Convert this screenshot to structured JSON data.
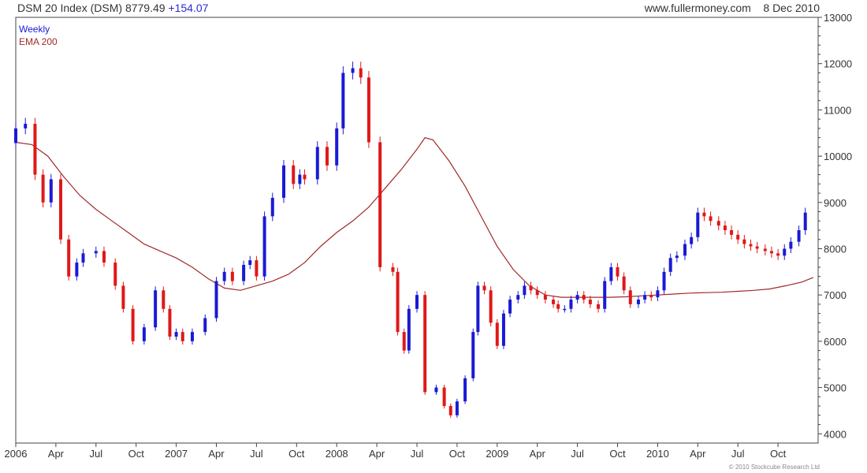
{
  "header": {
    "symbol": "DSM 20 Index (DSM)",
    "last": "8779.49",
    "change": "+154.07",
    "site": "www.fullermoney.com",
    "date": "8 Dec 2010"
  },
  "legend": {
    "weekly": "Weekly",
    "ema": "EMA 200"
  },
  "copyright": "© 2010 Stockcube Research Ltd",
  "colors": {
    "up": "#1a1ad4",
    "down": "#e01818",
    "ema": "#a02a2a",
    "grid": "#d9d9d9",
    "axis": "#444444"
  },
  "chart_data": {
    "type": "candlestick",
    "ylim": [
      3800,
      13000
    ],
    "y_ticks": [
      4000,
      5000,
      6000,
      7000,
      8000,
      9000,
      10000,
      11000,
      12000,
      13000
    ],
    "x_range": [
      2006.0,
      2011.0
    ],
    "x_ticks": [
      {
        "t": 2006.0,
        "label": "2006"
      },
      {
        "t": 2006.25,
        "label": "Apr"
      },
      {
        "t": 2006.5,
        "label": "Jul"
      },
      {
        "t": 2006.75,
        "label": "Oct"
      },
      {
        "t": 2007.0,
        "label": "2007"
      },
      {
        "t": 2007.25,
        "label": "Apr"
      },
      {
        "t": 2007.5,
        "label": "Jul"
      },
      {
        "t": 2007.75,
        "label": "Oct"
      },
      {
        "t": 2008.0,
        "label": "2008"
      },
      {
        "t": 2008.25,
        "label": "Apr"
      },
      {
        "t": 2008.5,
        "label": "Jul"
      },
      {
        "t": 2008.75,
        "label": "Oct"
      },
      {
        "t": 2009.0,
        "label": "2009"
      },
      {
        "t": 2009.25,
        "label": "Apr"
      },
      {
        "t": 2009.5,
        "label": "Jul"
      },
      {
        "t": 2009.75,
        "label": "Oct"
      },
      {
        "t": 2010.0,
        "label": "2010"
      },
      {
        "t": 2010.25,
        "label": "Apr"
      },
      {
        "t": 2010.5,
        "label": "Jul"
      },
      {
        "t": 2010.75,
        "label": "Oct"
      }
    ],
    "grid": true,
    "series": [
      {
        "name": "Weekly",
        "kind": "close",
        "x": [
          2006.0,
          2006.06,
          2006.12,
          2006.17,
          2006.22,
          2006.28,
          2006.33,
          2006.38,
          2006.42,
          2006.5,
          2006.55,
          2006.62,
          2006.67,
          2006.73,
          2006.8,
          2006.87,
          2006.92,
          2006.96,
          2007.0,
          2007.04,
          2007.1,
          2007.18,
          2007.25,
          2007.3,
          2007.35,
          2007.42,
          2007.46,
          2007.5,
          2007.55,
          2007.6,
          2007.67,
          2007.73,
          2007.77,
          2007.8,
          2007.88,
          2007.94,
          2008.0,
          2008.04,
          2008.1,
          2008.15,
          2008.2,
          2008.27,
          2008.35,
          2008.38,
          2008.42,
          2008.45,
          2008.5,
          2008.55,
          2008.62,
          2008.67,
          2008.71,
          2008.75,
          2008.8,
          2008.85,
          2008.88,
          2008.92,
          2008.96,
          2009.0,
          2009.04,
          2009.08,
          2009.13,
          2009.17,
          2009.21,
          2009.25,
          2009.3,
          2009.35,
          2009.38,
          2009.42,
          2009.46,
          2009.5,
          2009.54,
          2009.58,
          2009.63,
          2009.67,
          2009.71,
          2009.75,
          2009.79,
          2009.83,
          2009.88,
          2009.92,
          2009.96,
          2010.0,
          2010.04,
          2010.08,
          2010.12,
          2010.17,
          2010.21,
          2010.25,
          2010.29,
          2010.33,
          2010.38,
          2010.42,
          2010.46,
          2010.5,
          2010.54,
          2010.58,
          2010.62,
          2010.67,
          2010.71,
          2010.75,
          2010.79,
          2010.83,
          2010.88,
          2010.92
        ],
        "y": [
          10600,
          10700,
          9600,
          9000,
          9500,
          8200,
          7400,
          7700,
          7900,
          7950,
          7700,
          7200,
          6700,
          6000,
          6300,
          7100,
          6700,
          6100,
          6200,
          6000,
          6200,
          6500,
          7300,
          7500,
          7300,
          7650,
          7750,
          7400,
          8700,
          9100,
          9800,
          9400,
          9600,
          9500,
          10200,
          9800,
          10600,
          11800,
          11900,
          11700,
          10300,
          7600,
          7500,
          6200,
          5800,
          6700,
          7000,
          4900,
          5000,
          4600,
          4400,
          4700,
          5200,
          6200,
          7200,
          7100,
          6400,
          5900,
          6600,
          6900,
          7000,
          7200,
          7100,
          7000,
          6900,
          6800,
          6700,
          6700,
          6900,
          7000,
          6900,
          6800,
          6700,
          7300,
          7600,
          7400,
          7100,
          6800,
          6900,
          7000,
          6950,
          7100,
          7500,
          7800,
          7850,
          8100,
          8250,
          8780,
          8700,
          8600,
          8500,
          8400,
          8300,
          8200,
          8100,
          8050,
          8000,
          7950,
          7900,
          7850,
          8000,
          8150,
          8400,
          8780
        ]
      },
      {
        "name": "EMA 200",
        "kind": "line",
        "x": [
          2006.0,
          2006.1,
          2006.2,
          2006.3,
          2006.4,
          2006.5,
          2006.6,
          2006.7,
          2006.8,
          2006.9,
          2007.0,
          2007.1,
          2007.2,
          2007.3,
          2007.4,
          2007.5,
          2007.6,
          2007.7,
          2007.8,
          2007.9,
          2008.0,
          2008.1,
          2008.2,
          2008.3,
          2008.4,
          2008.5,
          2008.55,
          2008.6,
          2008.7,
          2008.8,
          2008.9,
          2009.0,
          2009.1,
          2009.2,
          2009.3,
          2009.4,
          2009.5,
          2009.6,
          2009.7,
          2009.8,
          2009.9,
          2010.0,
          2010.1,
          2010.2,
          2010.3,
          2010.4,
          2010.5,
          2010.6,
          2010.7,
          2010.8,
          2010.9,
          2010.97
        ],
        "y": [
          10300,
          10250,
          10000,
          9550,
          9150,
          8850,
          8600,
          8350,
          8100,
          7950,
          7800,
          7600,
          7350,
          7150,
          7100,
          7200,
          7300,
          7450,
          7700,
          8050,
          8350,
          8600,
          8900,
          9300,
          9700,
          10150,
          10400,
          10350,
          9900,
          9350,
          8700,
          8050,
          7550,
          7200,
          7000,
          6950,
          6950,
          6950,
          6950,
          6960,
          6980,
          7000,
          7020,
          7040,
          7050,
          7060,
          7080,
          7100,
          7130,
          7200,
          7280,
          7380
        ]
      }
    ]
  }
}
